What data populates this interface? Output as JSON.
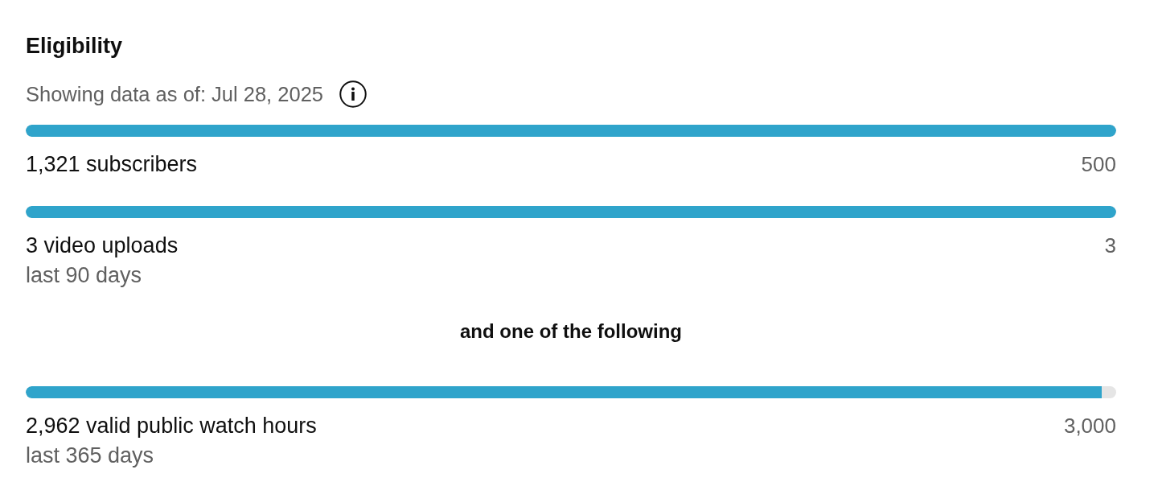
{
  "section": {
    "title": "Eligibility",
    "date_note": "Showing data as of: Jul 28, 2025"
  },
  "requirements": [
    {
      "label": "1,321 subscribers",
      "target": "500",
      "level": 1
    },
    {
      "label": "3 video uploads",
      "period": "last 90 days",
      "target": "3",
      "level": 1
    }
  ],
  "separator": "and one of the following",
  "alternatives": [
    {
      "label": "2,962 valid public watch hours",
      "period": "last 365 days",
      "target": "3,000",
      "level": 0.987
    }
  ]
}
